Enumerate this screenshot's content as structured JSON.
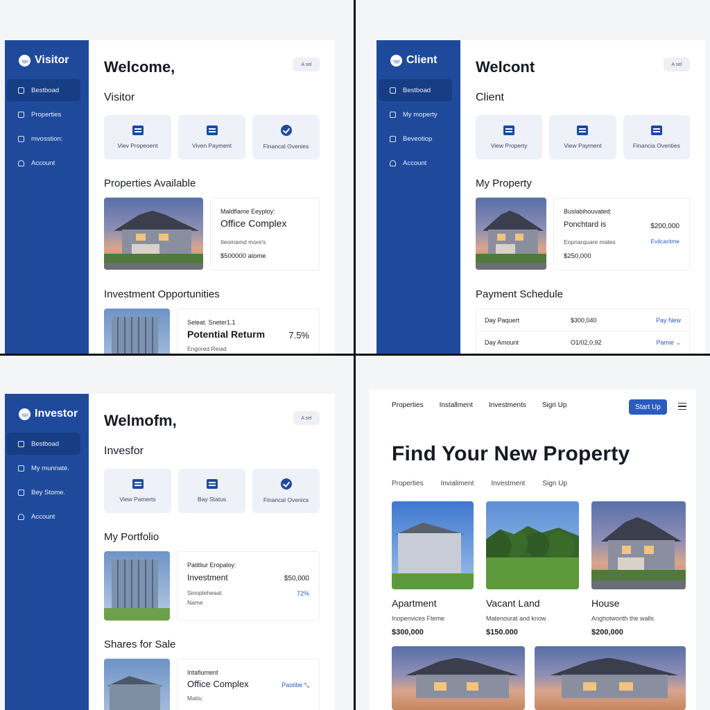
{
  "visitor": {
    "brand": "Visitor",
    "nav": [
      "Bestboad",
      "Properties",
      "mvosstion:",
      "Account"
    ],
    "welcome": "Welcome,",
    "role": "Visitor",
    "pill": "A sel",
    "cards": [
      "Viev Propeoent",
      "Viven Payment",
      "Financal Ovenies"
    ],
    "section1": "Properties Available",
    "prop": {
      "small": "Maldflame Eeyploy:",
      "big": "Office Complex",
      "muted": "Iteomamd more's",
      "price": "$500000 alome"
    },
    "section2": "Investment Opportunities",
    "invest": {
      "small": "Seleat. Sneter1.1",
      "big": "Potential Returm",
      "value": "7.5%",
      "muted": "Engored Reiad"
    }
  },
  "client": {
    "brand": "Client",
    "nav": [
      "Bestboad",
      "My moperty",
      "Beveotiop",
      "Account"
    ],
    "welcome": "Welcont",
    "role": "Client",
    "pill": "A sel",
    "cards": [
      "View Property",
      "View Payment",
      "Financia Oventies"
    ],
    "section1": "My Property",
    "prop": {
      "small": "Buslabihouvated:",
      "big": "Ponchtard is",
      "right": "$200,000",
      "muted": "Eopriarquare mates",
      "link": "Evilcaritme",
      "price": "$250,000"
    },
    "section2": "Payment Schedule",
    "schedule": [
      {
        "label": "Day Paquert",
        "value": "$300,040",
        "action": "Pay New"
      },
      {
        "label": "Day Amount",
        "value": "O1/02,0,92",
        "action": "Pamie ⌄"
      }
    ]
  },
  "investor": {
    "brand": "Investor",
    "nav": [
      "Bestboad",
      "My munnate.",
      "Bey Stome.",
      "Account"
    ],
    "welcome": "Welmofm,",
    "role": "Invesfor",
    "pill": "A sel",
    "cards": [
      "View Pamerts",
      "Bay Status",
      "Financal Ovenics"
    ],
    "section1": "My Portfolio",
    "prop": {
      "small": "Patitliur Eropaloy:",
      "big": "Investment",
      "right": "$50,000",
      "muted": "Sinopleheaat",
      "link": "72%",
      "muted2": "Name"
    },
    "section2": "Shares for Sale",
    "share": {
      "small": "Intafiument",
      "big": "Office Complex",
      "link": "Pastibe ⤡",
      "muted": "Matis:"
    }
  },
  "site": {
    "nav": [
      "Properties",
      "Installment",
      "Investments",
      "Sign Up"
    ],
    "cta": "Start Up",
    "hero": "Find Your New Property",
    "subnav": [
      "Properties",
      "Invialiment",
      "Investment",
      "Sign Up"
    ],
    "listings": [
      {
        "title": "Apartment",
        "desc": "Inopenvices Fteme",
        "price": "$300,000"
      },
      {
        "title": "Vacant Land",
        "desc": "Matenourat and know",
        "price": "$150.000"
      },
      {
        "title": "House",
        "desc": "Anghotworith the walls",
        "price": "$200,000"
      }
    ]
  },
  "colors": {
    "sidebar": "#1f4a9c",
    "accent": "#2b5bbf"
  }
}
